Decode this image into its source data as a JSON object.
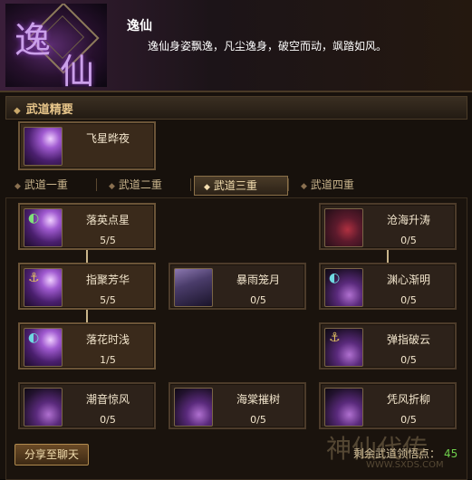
{
  "header": {
    "emblem_char1": "逸",
    "emblem_char2": "仙",
    "title": "逸仙",
    "description": "逸仙身姿飘逸，凡尘逸身，破空而动，飒踏如风。"
  },
  "summary": {
    "heading": "武道精要",
    "skill": {
      "name": "飞星晔夜",
      "icon": "star-night-icon"
    }
  },
  "tabs": [
    {
      "label": "武道一重",
      "active": false
    },
    {
      "label": "武道二重",
      "active": false
    },
    {
      "label": "武道三重",
      "active": true
    },
    {
      "label": "武道四重",
      "active": false
    }
  ],
  "skills": {
    "luoying": {
      "name": "落英点星",
      "count": "5/5",
      "icon": "falling-blossom-icon",
      "active": true
    },
    "zhiju": {
      "name": "指聚芳华",
      "count": "5/5",
      "icon": "finger-gather-icon",
      "active": true
    },
    "luohua": {
      "name": "落花时浅",
      "count": "1/5",
      "icon": "falling-flower-icon",
      "active": true
    },
    "chaoyin": {
      "name": "潮音惊风",
      "count": "0/5",
      "icon": "tide-wind-icon",
      "active": false
    },
    "baoyu": {
      "name": "暴雨笼月",
      "count": "0/5",
      "icon": "storm-moon-icon",
      "active": false
    },
    "haitang": {
      "name": "海棠摧树",
      "count": "0/5",
      "icon": "begonia-icon",
      "active": false
    },
    "canghai": {
      "name": "沧海升涛",
      "count": "0/5",
      "icon": "sea-wave-icon",
      "active": false
    },
    "yuanxin": {
      "name": "渊心渐明",
      "count": "0/5",
      "icon": "abyss-heart-icon",
      "active": false
    },
    "tanzhi": {
      "name": "弹指破云",
      "count": "0/5",
      "icon": "flick-cloud-icon",
      "active": false
    },
    "pingfeng": {
      "name": "凭风折柳",
      "count": "0/5",
      "icon": "wind-willow-icon",
      "active": false
    }
  },
  "footer": {
    "share_label": "分享至聊天",
    "remaining_label": "剩余武道领悟点：",
    "remaining_value": "45"
  },
  "watermark": {
    "logo": "神仙代传",
    "url": "WWW.SXDS.COM"
  }
}
